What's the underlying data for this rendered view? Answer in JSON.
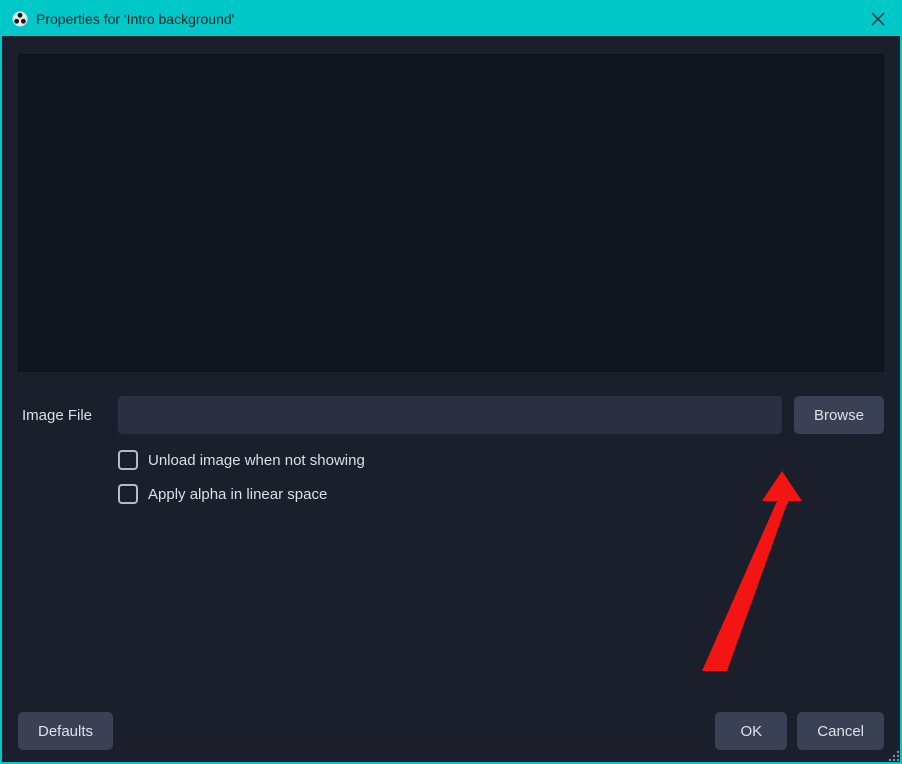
{
  "titlebar": {
    "title": "Properties for 'Intro background'"
  },
  "form": {
    "image_file_label": "Image File",
    "image_file_value": "",
    "browse_label": "Browse",
    "unload_label": "Unload image when not showing",
    "alpha_label": "Apply alpha in linear space"
  },
  "footer": {
    "defaults_label": "Defaults",
    "ok_label": "OK",
    "cancel_label": "Cancel"
  },
  "colors": {
    "accent": "#01c8c8",
    "background": "#1a1f2b",
    "panel": "#11151e",
    "input": "#2a3042",
    "button": "#3a4155",
    "text": "#dcdfe5",
    "arrow": "#f31414"
  }
}
